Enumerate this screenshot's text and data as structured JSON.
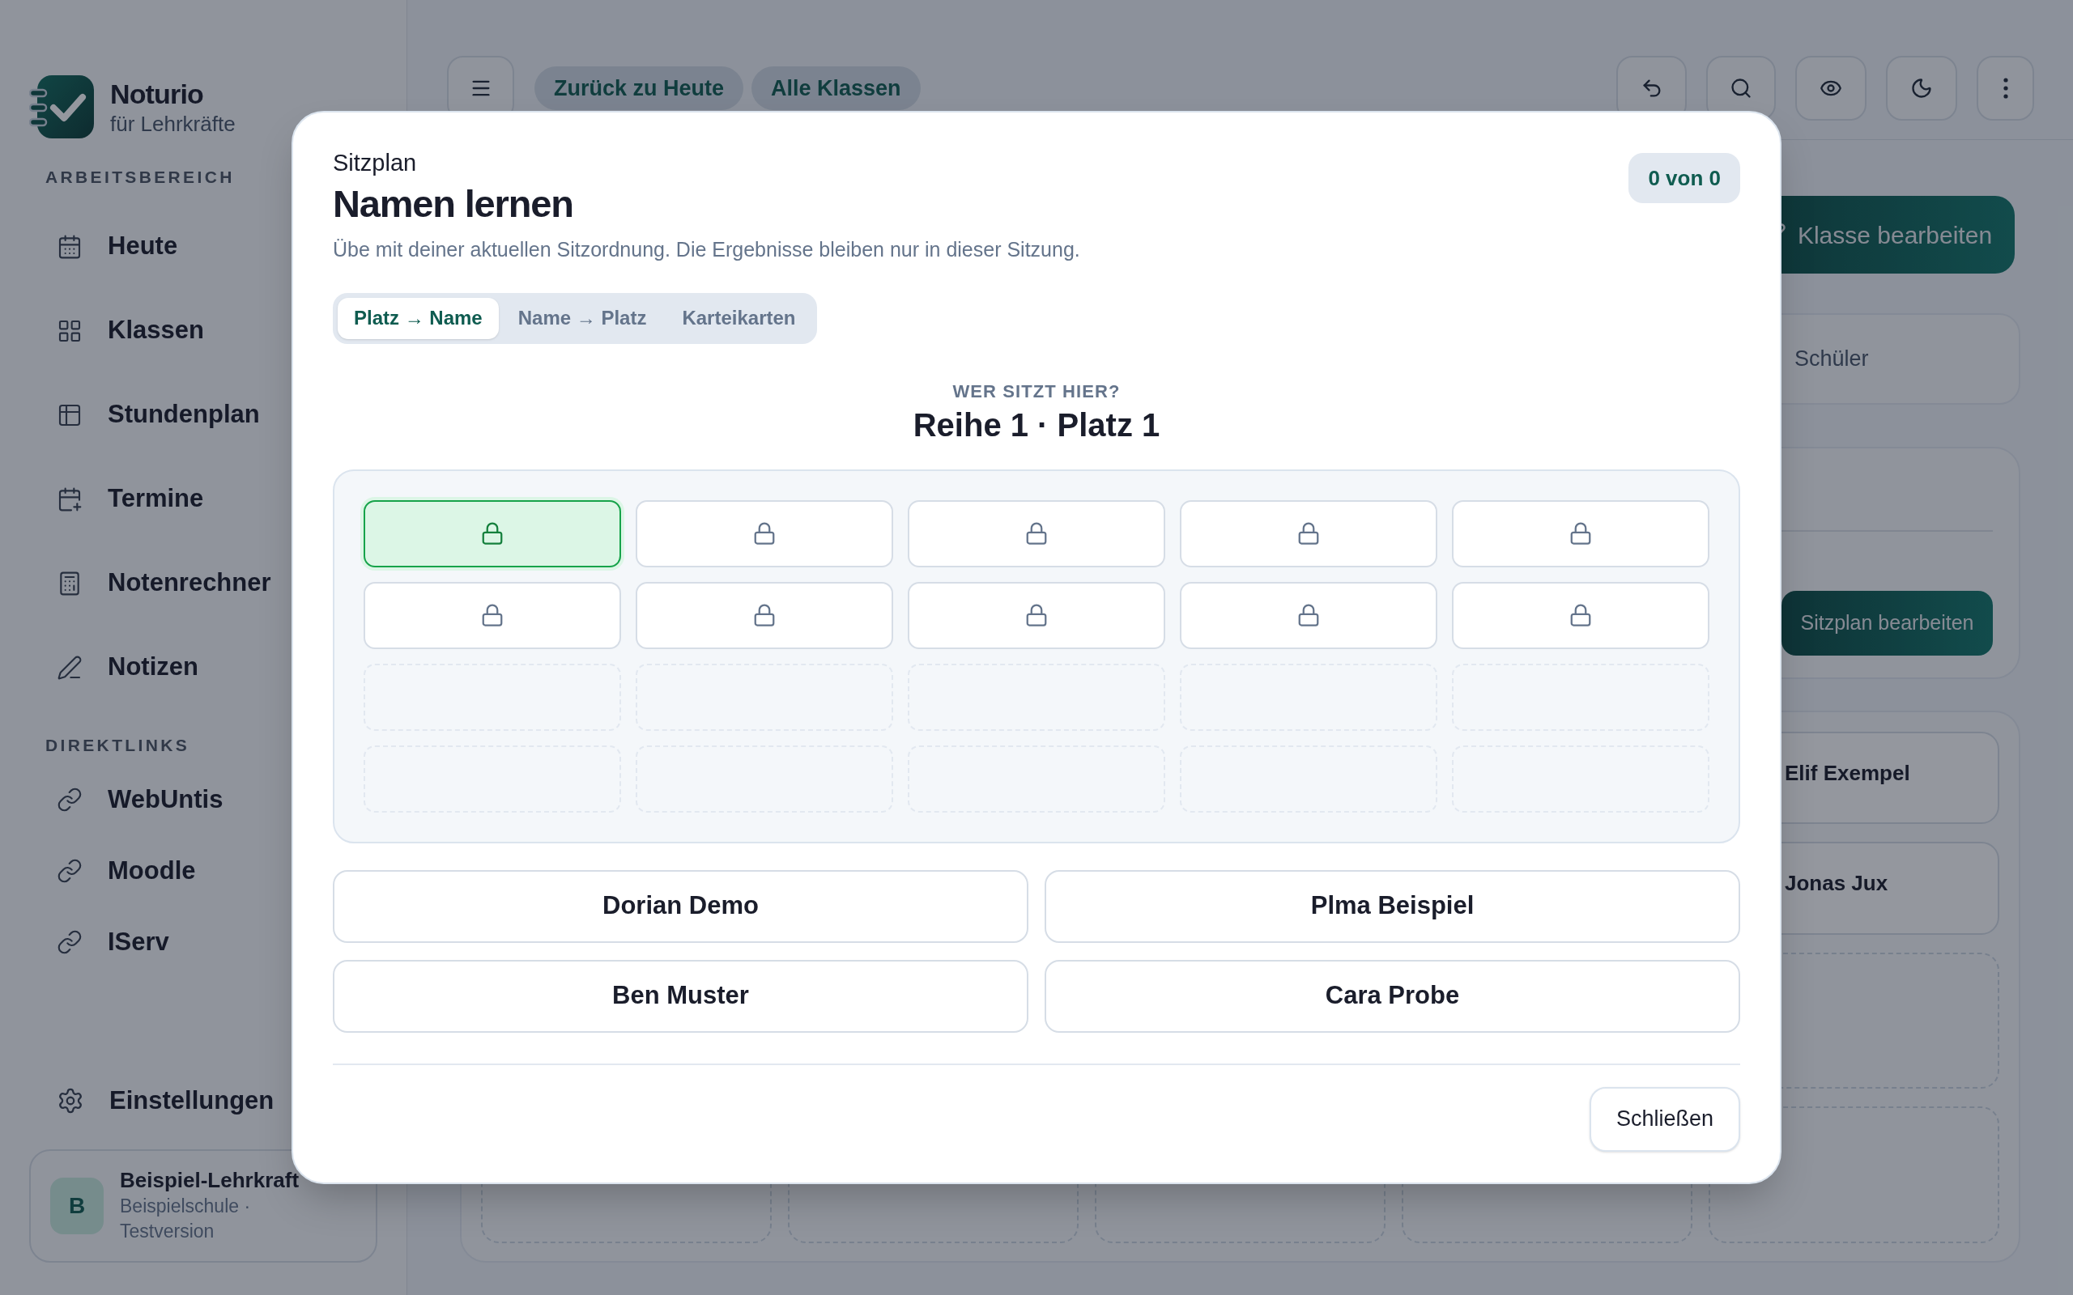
{
  "sidebar": {
    "brand": {
      "name": "Noturio",
      "tagline": "für Lehrkräfte"
    },
    "sections": [
      {
        "heading": "ARBEITSBEREICH",
        "items": [
          {
            "label": "Heute"
          },
          {
            "label": "Klassen"
          },
          {
            "label": "Stundenplan"
          },
          {
            "label": "Termine"
          },
          {
            "label": "Notenrechner"
          },
          {
            "label": "Notizen"
          }
        ]
      },
      {
        "heading": "DIREKTLINKS",
        "items": [
          {
            "label": "WebUntis"
          },
          {
            "label": "Moodle"
          },
          {
            "label": "IServ"
          }
        ]
      }
    ],
    "settings": "Einstellungen",
    "user": {
      "initial": "B",
      "name": "Beispiel-Lehrkraft",
      "detail": "Beispielschule · Testversion"
    }
  },
  "topbar": {
    "pills": [
      "Zurück zu Heute",
      "Alle Klassen"
    ]
  },
  "content": {
    "edit_class_button": "Klasse bearbeiten",
    "tab_label": "Schüler",
    "edit_seating_button": "Sitzplan bearbeiten",
    "student_tiles": [
      {
        "kind": "student",
        "name": "Elif Exempel"
      },
      {
        "kind": "student",
        "name": "Jonas Jux"
      },
      {
        "kind": "empty"
      },
      {
        "kind": "empty"
      }
    ]
  },
  "dialog": {
    "eyebrow": "Sitzplan",
    "title": "Namen lernen",
    "description": "Übe mit deiner aktuellen Sitzordnung. Die Ergebnisse bleiben nur in dieser Sitzung.",
    "score": "0 von 0",
    "tabs": [
      {
        "label": "Platz → Name",
        "selected": true
      },
      {
        "label": "Name → Platz",
        "selected": false
      },
      {
        "label": "Karteikarten",
        "selected": false
      }
    ],
    "prompt": "WER SITZT HIER?",
    "seat_label": "Reihe 1 · Platz 1",
    "seat_rows": [
      [
        {
          "kind": "occupied",
          "selected": true
        },
        {
          "kind": "occupied",
          "selected": false
        },
        {
          "kind": "occupied",
          "selected": false
        },
        {
          "kind": "occupied",
          "selected": false
        },
        {
          "kind": "occupied",
          "selected": false
        }
      ],
      [
        {
          "kind": "occupied",
          "selected": false
        },
        {
          "kind": "occupied",
          "selected": false
        },
        {
          "kind": "occupied",
          "selected": false
        },
        {
          "kind": "occupied",
          "selected": false
        },
        {
          "kind": "occupied",
          "selected": false
        }
      ],
      [
        {
          "kind": "empty",
          "selected": false
        },
        {
          "kind": "empty",
          "selected": false
        },
        {
          "kind": "empty",
          "selected": false
        },
        {
          "kind": "empty",
          "selected": false
        },
        {
          "kind": "empty",
          "selected": false
        }
      ],
      [
        {
          "kind": "empty",
          "selected": false
        },
        {
          "kind": "empty",
          "selected": false
        },
        {
          "kind": "empty",
          "selected": false
        },
        {
          "kind": "empty",
          "selected": false
        },
        {
          "kind": "empty",
          "selected": false
        }
      ]
    ],
    "answers": [
      "Dorian Demo",
      "Plma Beispiel",
      "Ben Muster",
      "Cara Probe"
    ],
    "close_button": "Schließen"
  }
}
